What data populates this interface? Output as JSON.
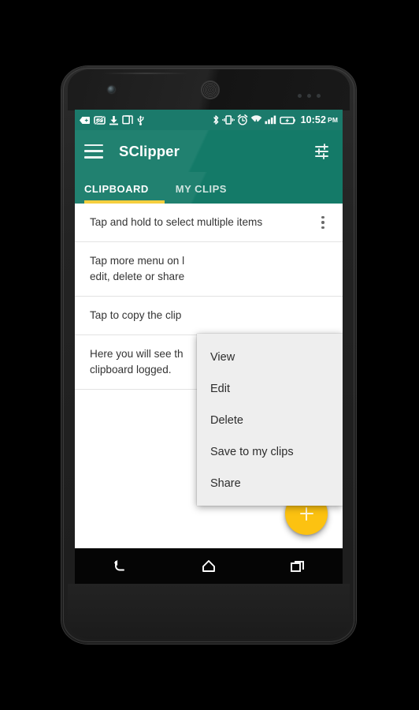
{
  "status_bar": {
    "time": "10:52",
    "ampm": "PM",
    "icons_left": [
      "back-arrow-badge-icon",
      "no-sim-card-icon",
      "download-icon",
      "screenshot-icon",
      "usb-icon"
    ],
    "icons_right": [
      "bluetooth-icon",
      "vibrate-icon",
      "alarm-icon",
      "wifi-icon",
      "signal-bars-icon",
      "battery-charging-icon"
    ]
  },
  "toolbar": {
    "menu_icon": "hamburger-menu-icon",
    "title": "SClipper",
    "settings_icon": "tune-sliders-icon",
    "background_color": "#147a68"
  },
  "tabs": {
    "items": [
      {
        "label": "CLIPBOARD",
        "active": true
      },
      {
        "label": "MY CLIPS",
        "active": false
      }
    ],
    "indicator_color": "#f5cf3f"
  },
  "list": {
    "items": [
      {
        "text": "Tap and hold to select multiple items",
        "has_overflow": true
      },
      {
        "text": "Tap more menu on l\nedit, delete or share",
        "has_overflow": false
      },
      {
        "text": "Tap to copy the clip",
        "has_overflow": false
      },
      {
        "text": "Here you will see th\nclipboard logged.",
        "has_overflow": false
      }
    ]
  },
  "popup_menu": {
    "items": [
      {
        "label": "View"
      },
      {
        "label": "Edit"
      },
      {
        "label": "Delete"
      },
      {
        "label": "Save to my clips"
      },
      {
        "label": "Share"
      }
    ]
  },
  "fab": {
    "icon": "plus-icon",
    "color": "#fcc211"
  },
  "nav_bar": {
    "buttons": [
      {
        "name": "back-icon"
      },
      {
        "name": "home-icon"
      },
      {
        "name": "recents-icon"
      }
    ]
  }
}
